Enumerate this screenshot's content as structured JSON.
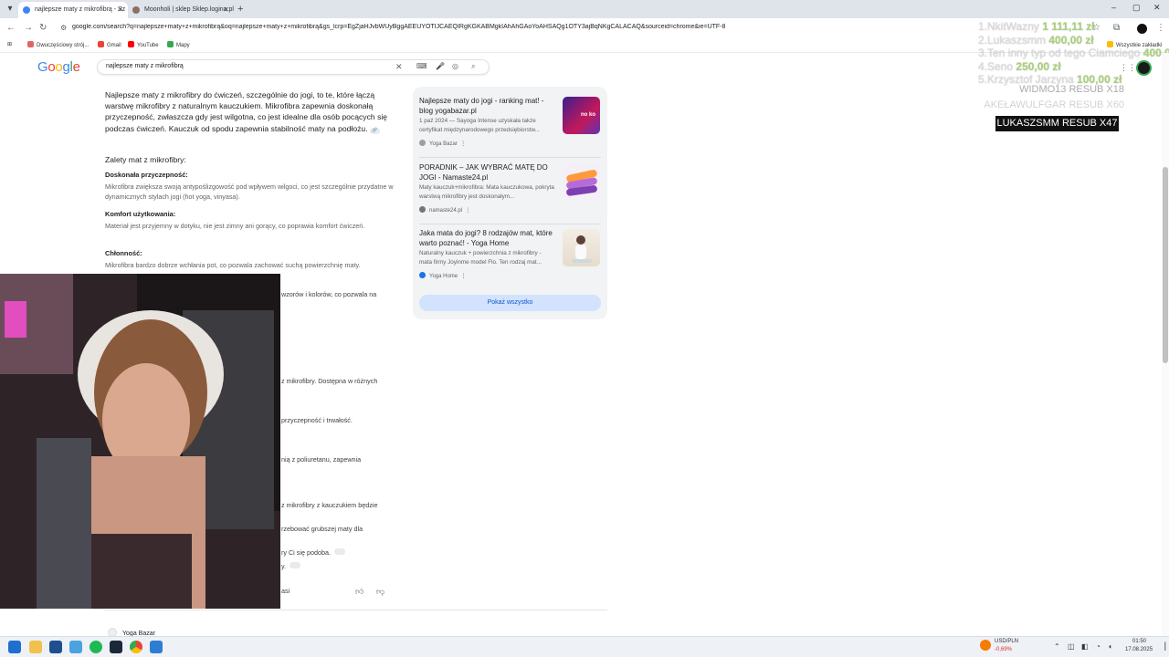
{
  "browser": {
    "tabs": [
      {
        "label": "najlepsze maty z mikrofibrą - Sz",
        "active": true
      },
      {
        "label": "Moonholi | sklep Sklep.logina.pl",
        "active": false
      }
    ],
    "url": "google.com/search?q=najlepsze+maty+z+mikrofibrą&oq=najlepsze+maty+z+mikrofibrą&gs_lcrp=EgZjaHJvbWUyBggAEEUYOTIJCAEQIRgKGKABMgkIAhAhGAoYoAHSAQg1OTY3ajBqNKgCALACAQ&sourceid=chrome&ie=UTF-8",
    "bookmarks": [
      "Dwuczęściowy strój...",
      "Gmail",
      "YouTube",
      "Mapy"
    ],
    "all_bookmarks": "Wszystkie zakładki"
  },
  "search": {
    "logo": "Google",
    "query": "najlepsze maty z mikrofibrą"
  },
  "ai_overview": {
    "lead": "Najlepsze maty z mikrofibry do ćwiczeń, szczególnie do jogi, to te, które łączą warstwę mikrofibry z naturalnym kauczukiem. Mikrofibra zapewnia doskonałą przyczepność, zwłaszcza gdy jest wilgotna, co jest idealne dla osób pocących się podczas ćwiczeń. Kauczuk od spodu zapewnia stabilność maty na podłożu.",
    "advantages_heading": "Zalety mat z mikrofibry:",
    "items": [
      {
        "title": "Doskonała przyczepność:",
        "text": "Mikrofibra zwiększa swoją antypoślizgowość pod wpływem wilgoci, co jest szczególnie przydatne w dynamicznych stylach jogi (hot yoga, vinyasa)."
      },
      {
        "title": "Komfort użytkowania:",
        "text": "Materiał jest przyjemny w dotyku, nie jest zimny ani gorący, co poprawia komfort ćwiczeń."
      },
      {
        "title": "Chłonność:",
        "text": "Mikrofibra bardzo dobrze wchłania pot, co pozwala zachować suchą powierzchnię maty."
      }
    ],
    "fragments": [
      "wzorów i kolorów, co pozwala na",
      "z mikrofibry. Dostępna w różnych",
      "przyczepność i trwałość.",
      "nią z poliuretanu, zapewnia",
      "z mikrofibry z kauczukiem będzie",
      "rzebować grubszej maty dla",
      "ry Ci się podoba.",
      "y.",
      "asi"
    ],
    "bottom_source": "Yoga Bazar"
  },
  "sources": {
    "cards": [
      {
        "title": "Najlepsze maty do jogi - ranking mat! - blog yogabazar.pl",
        "snippet": "1 paź 2024 — Sayoga Intense uzyskała także certyfikat międzynarodowego przedsiębiorstw...",
        "site": "Yoga Bazar",
        "thumb_text": "no ko"
      },
      {
        "title": "PORADNIK – JAK WYBRAĆ MATĘ DO JOGI - Namaste24.pl",
        "snippet": "Maty kauczuk+mikrofibra: Mata kauczukowa, pokryta warstwą mikrofibry jest doskonałym...",
        "site": "namaste24.pl"
      },
      {
        "title": "Jaka mata do jogi? 8 rodzajów mat, które warto poznać! - Yoga Home",
        "snippet": "Naturalny kauczuk + powierzchnia z mikrofibry - mata firmy Joyinme model Flo. Ten rodzaj mat...",
        "site": "Yoga Home"
      }
    ],
    "show_all": "Pokaż wszystko"
  },
  "stream_overlay": {
    "donors": [
      {
        "name": "1.NkitWazny",
        "amount": "1 111,11 zł"
      },
      {
        "name": "2.Lukaszsmm",
        "amount": "400,00 zł"
      },
      {
        "name": "3.Ten inny typ od tego Ciamciego",
        "amount": "400,00"
      },
      {
        "name": "4.Seno",
        "amount": "250,00 zł"
      },
      {
        "name": "5.Krzysztof Jarzyna",
        "amount": "100,00 zł"
      }
    ],
    "subs": [
      {
        "text": "WIDMO13   RESUB X18"
      },
      {
        "text": "AKEŁAWULFGAR   RESUB X60"
      }
    ],
    "highlight": "LUKASZSMM   RESUB X47"
  },
  "taskbar": {
    "ticker_name": "USD/PLN",
    "ticker_change": "-0,69%",
    "time": "01:50",
    "date": "17.08.2025"
  },
  "colors": {
    "accent": "#0b57d0",
    "show_all_bg": "#d3e3fd",
    "donor_amount": "#9ccc65"
  }
}
